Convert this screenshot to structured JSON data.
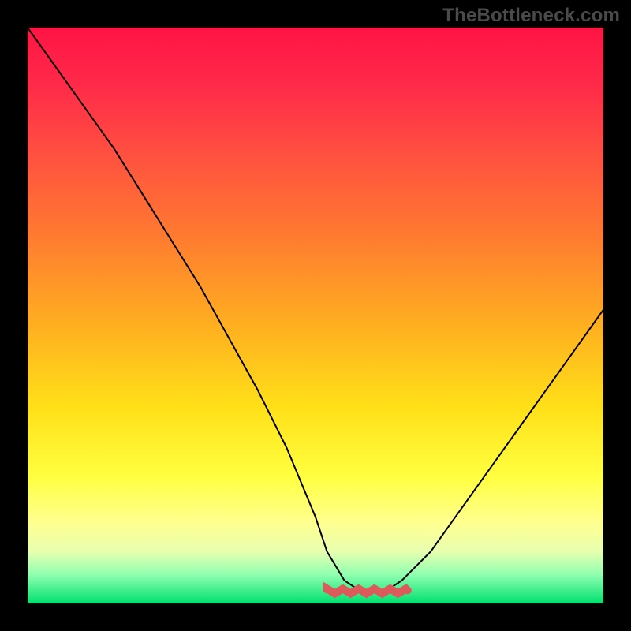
{
  "watermark": "TheBottleneck.com",
  "chart_data": {
    "type": "line",
    "title": "",
    "xlabel": "",
    "ylabel": "",
    "xlim": [
      0,
      100
    ],
    "ylim": [
      0,
      100
    ],
    "grid": false,
    "legend": false,
    "series": [
      {
        "name": "bottleneck-curve",
        "color": "#000000",
        "x": [
          0,
          5,
          10,
          15,
          20,
          25,
          30,
          35,
          40,
          45,
          50,
          52,
          55,
          58,
          60,
          62,
          65,
          70,
          75,
          80,
          85,
          90,
          95,
          100
        ],
        "y": [
          100,
          93,
          86,
          79,
          71,
          63,
          55,
          46,
          37,
          27,
          15,
          9,
          4,
          2,
          2,
          2,
          4,
          9,
          16,
          23,
          30,
          37,
          44,
          51
        ]
      }
    ],
    "annotations": [
      {
        "name": "optimal-band",
        "color": "#e06060",
        "x_start": 52,
        "x_end": 66,
        "y": 2
      }
    ],
    "background_gradient": {
      "orientation": "vertical-top-to-bottom",
      "stops": [
        {
          "pos": 0.0,
          "color": "#ff1445"
        },
        {
          "pos": 0.1,
          "color": "#ff2a49"
        },
        {
          "pos": 0.22,
          "color": "#ff5040"
        },
        {
          "pos": 0.36,
          "color": "#ff7a30"
        },
        {
          "pos": 0.52,
          "color": "#ffb020"
        },
        {
          "pos": 0.66,
          "color": "#ffe018"
        },
        {
          "pos": 0.78,
          "color": "#ffff40"
        },
        {
          "pos": 0.86,
          "color": "#ffff90"
        },
        {
          "pos": 0.91,
          "color": "#e8ffb0"
        },
        {
          "pos": 0.95,
          "color": "#90ffb0"
        },
        {
          "pos": 1.0,
          "color": "#00e070"
        }
      ]
    }
  }
}
